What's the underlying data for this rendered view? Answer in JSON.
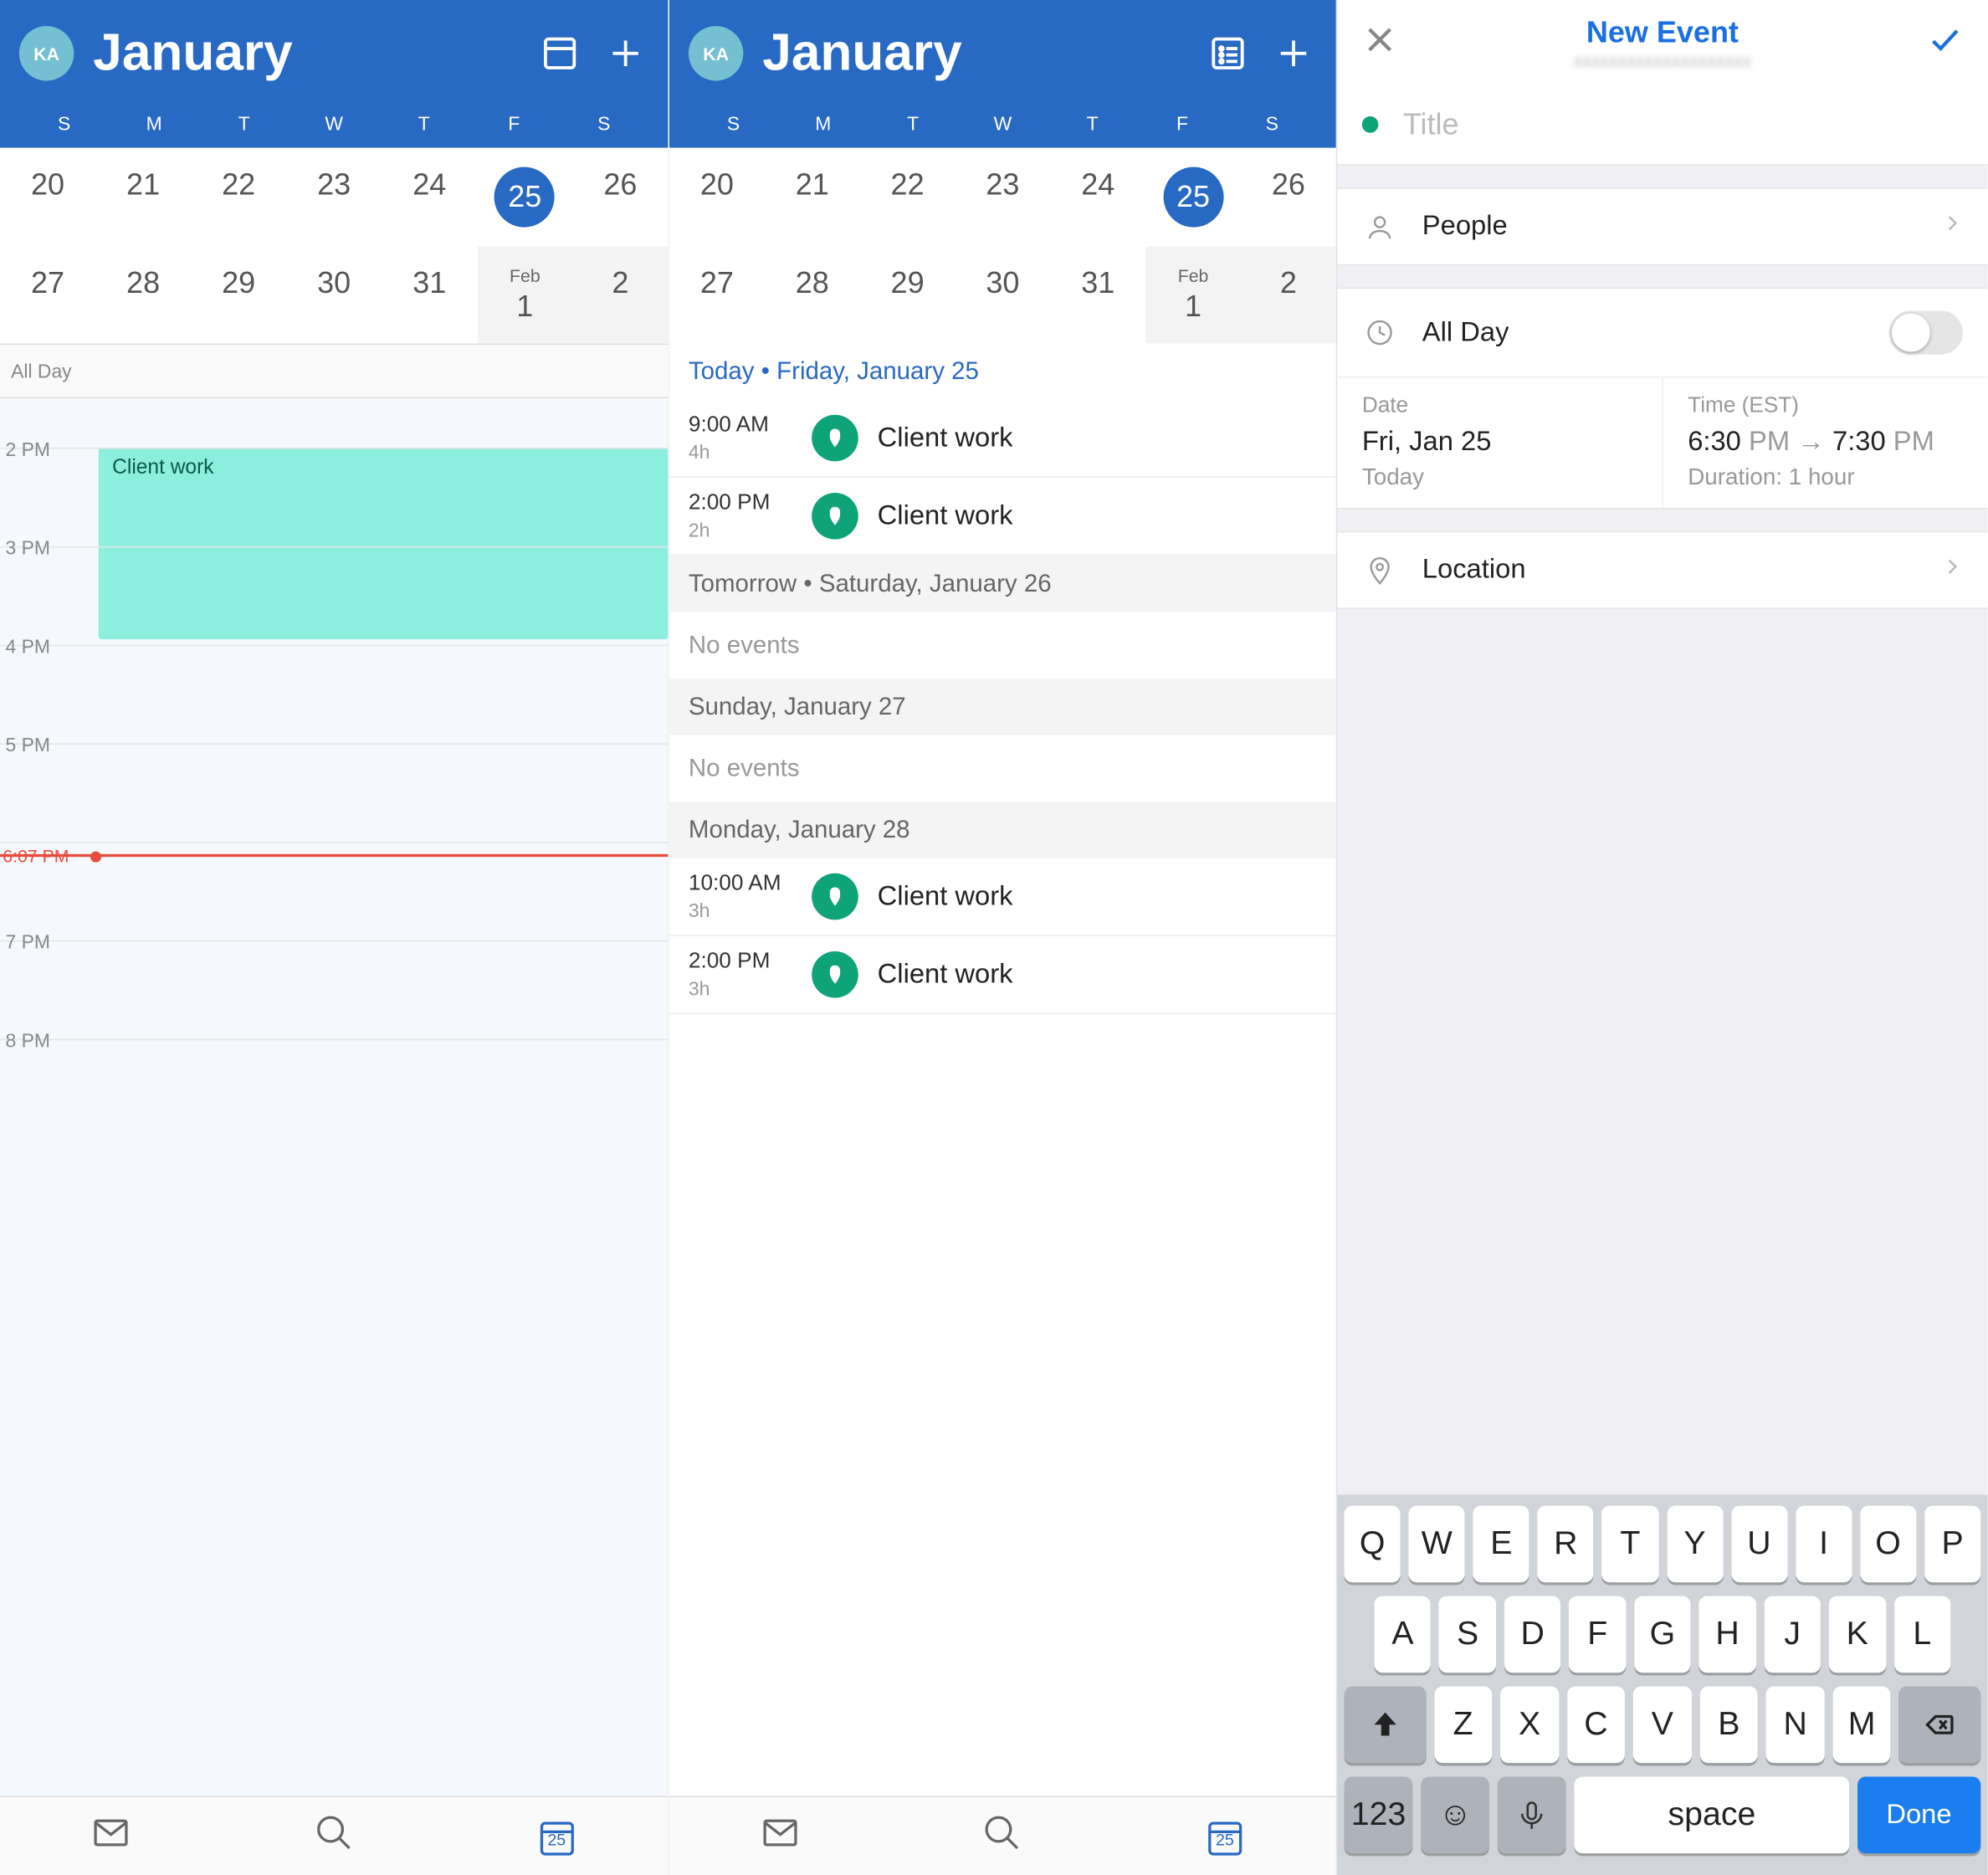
{
  "avatar_initials": "KA",
  "month": "January",
  "dow": [
    "S",
    "M",
    "T",
    "W",
    "T",
    "F",
    "S"
  ],
  "dates_row1": [
    "20",
    "21",
    "22",
    "23",
    "24",
    "25",
    "26"
  ],
  "dates_row2": [
    "27",
    "28",
    "29",
    "30",
    "31",
    "1",
    "2"
  ],
  "feb_label": "Feb",
  "selected_date": "25",
  "allday_label": "All Day",
  "hours": [
    "2 PM",
    "3 PM",
    "4 PM",
    "5 PM",
    "",
    "7 PM",
    "8 PM"
  ],
  "now_time_label": "6:07 PM",
  "day_event_title": "Client work",
  "tabbar_date": "25",
  "agenda": {
    "today_header": "Today • Friday, January 25",
    "today_items": [
      {
        "time": "9:00 AM",
        "dur": "4h",
        "title": "Client work"
      },
      {
        "time": "2:00 PM",
        "dur": "2h",
        "title": "Client work"
      }
    ],
    "sections": [
      {
        "header": "Tomorrow • Saturday, January 26",
        "empty": "No events"
      },
      {
        "header": "Sunday, January 27",
        "empty": "No events"
      },
      {
        "header": "Monday, January 28",
        "items": [
          {
            "time": "10:00 AM",
            "dur": "3h",
            "title": "Client work"
          },
          {
            "time": "2:00 PM",
            "dur": "3h",
            "title": "Client work"
          }
        ]
      }
    ]
  },
  "new_event": {
    "header_title": "New Event",
    "title_placeholder": "Title",
    "people_label": "People",
    "allday_label": "All Day",
    "date_label": "Date",
    "date_value": "Fri, Jan 25",
    "date_sub": "Today",
    "time_label": "Time (EST)",
    "time_start": "6:30",
    "time_start_ampm": "PM",
    "time_arrow": "→",
    "time_end": "7:30",
    "time_end_ampm": "PM",
    "duration": "Duration: 1 hour",
    "location_label": "Location"
  },
  "keyboard": {
    "row1": [
      "Q",
      "W",
      "E",
      "R",
      "T",
      "Y",
      "U",
      "I",
      "O",
      "P"
    ],
    "row2": [
      "A",
      "S",
      "D",
      "F",
      "G",
      "H",
      "J",
      "K",
      "L"
    ],
    "row3": [
      "Z",
      "X",
      "C",
      "V",
      "B",
      "N",
      "M"
    ],
    "num": "123",
    "space": "space",
    "done": "Done"
  }
}
